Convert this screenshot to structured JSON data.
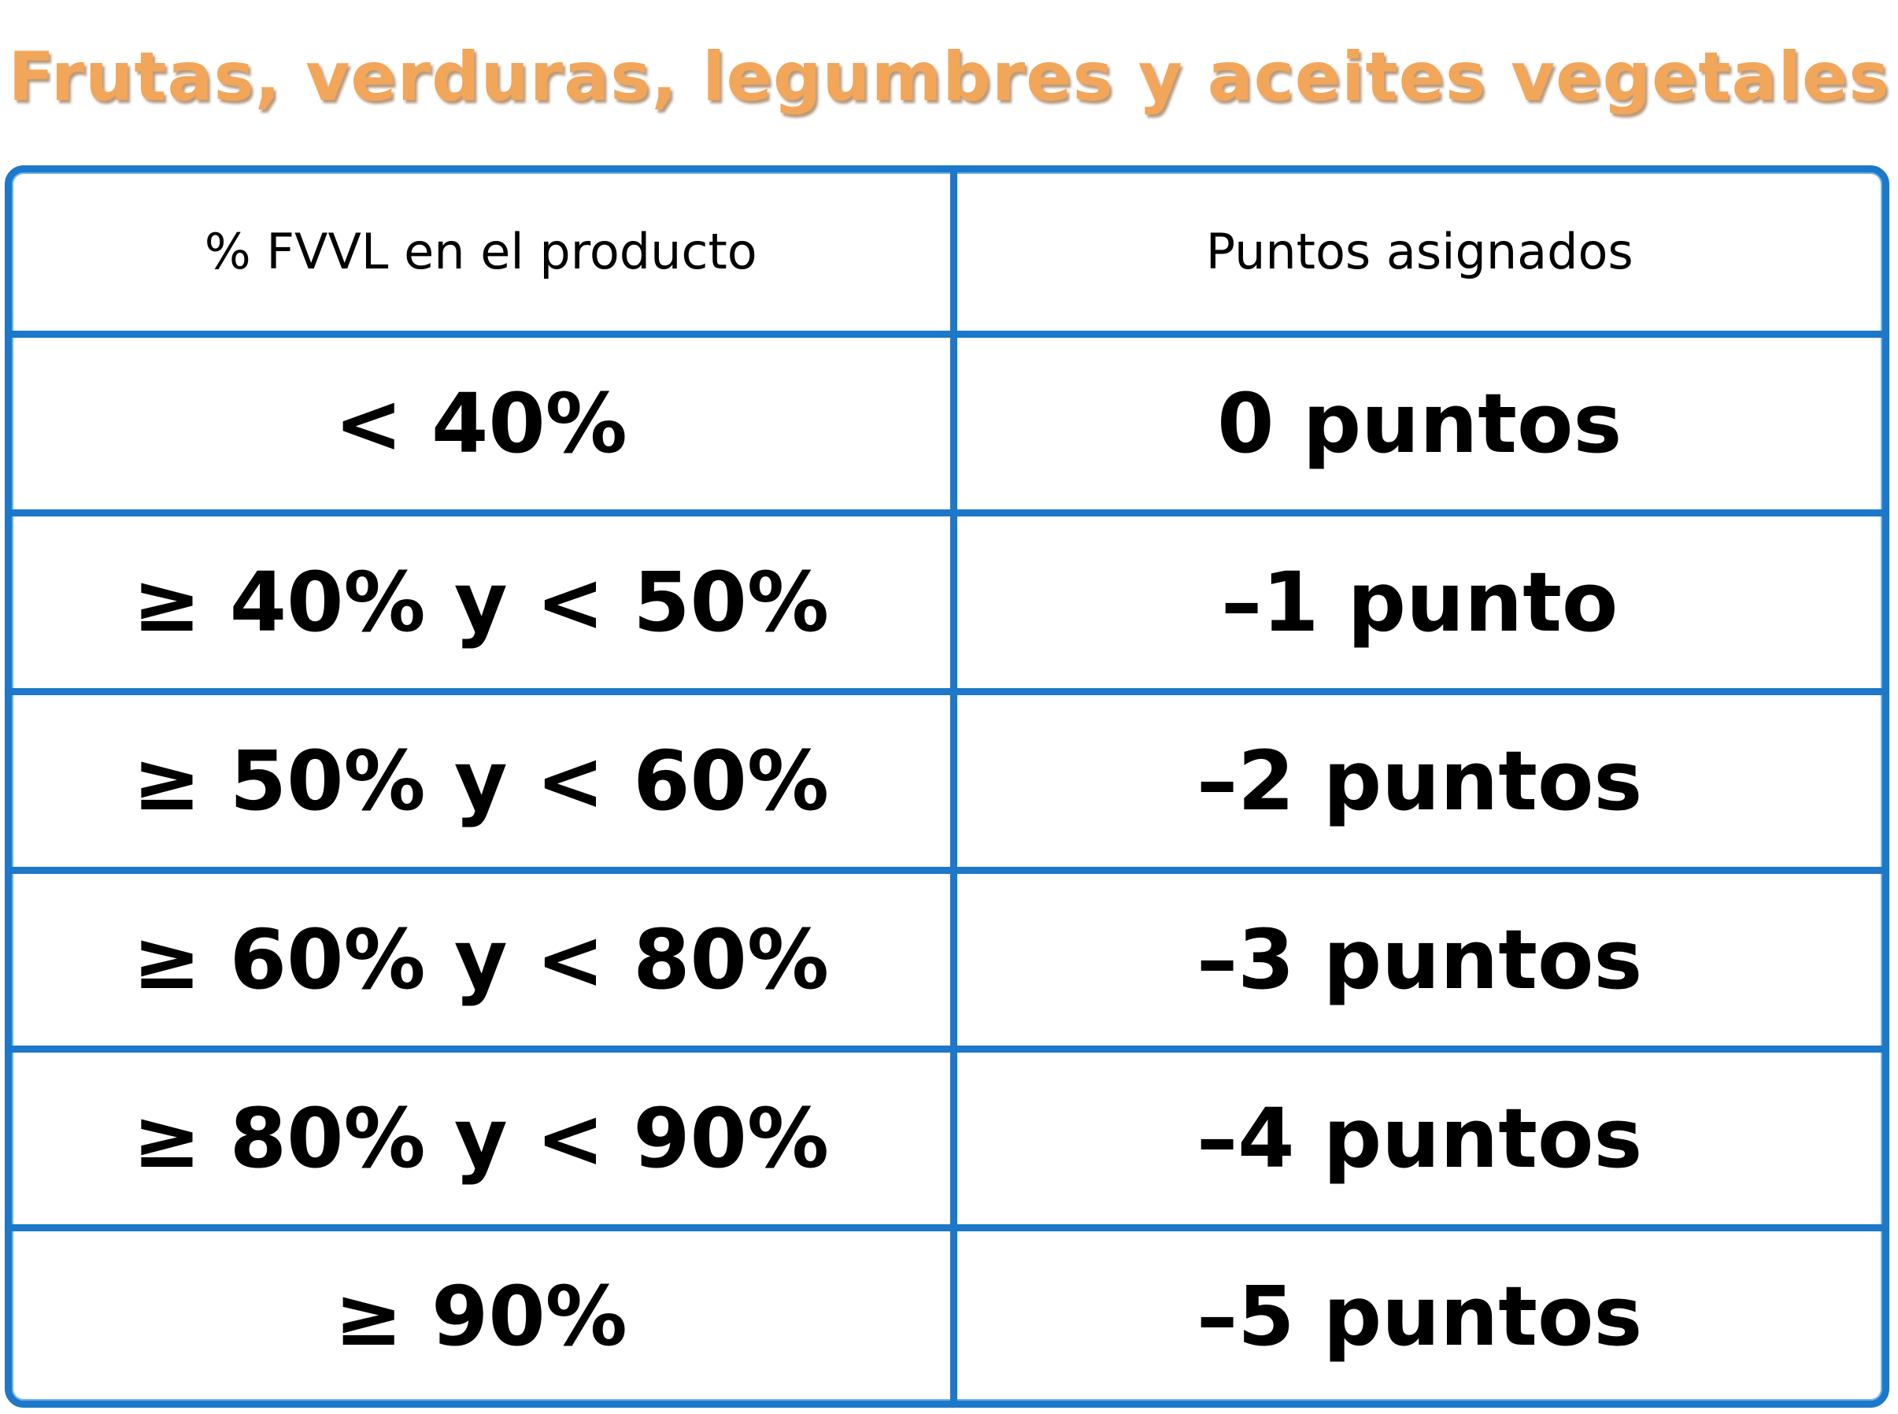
{
  "title": "Frutas, verduras, legumbres y aceites vegetales",
  "table": {
    "headers": [
      "% FVVL en el producto",
      "Puntos asignados"
    ],
    "rows": [
      [
        "< 40%",
        "0 puntos"
      ],
      [
        "≥ 40% y < 50%",
        "–1 punto"
      ],
      [
        "≥ 50% y < 60%",
        "–2 puntos"
      ],
      [
        "≥ 60% y < 80%",
        "–3 puntos"
      ],
      [
        "≥ 80% y < 90%",
        "–4 puntos"
      ],
      [
        "≥ 90%",
        "–5 puntos"
      ]
    ]
  },
  "colors": {
    "title": "#f2a65a",
    "border": "#1d78c9",
    "text": "#000000"
  }
}
